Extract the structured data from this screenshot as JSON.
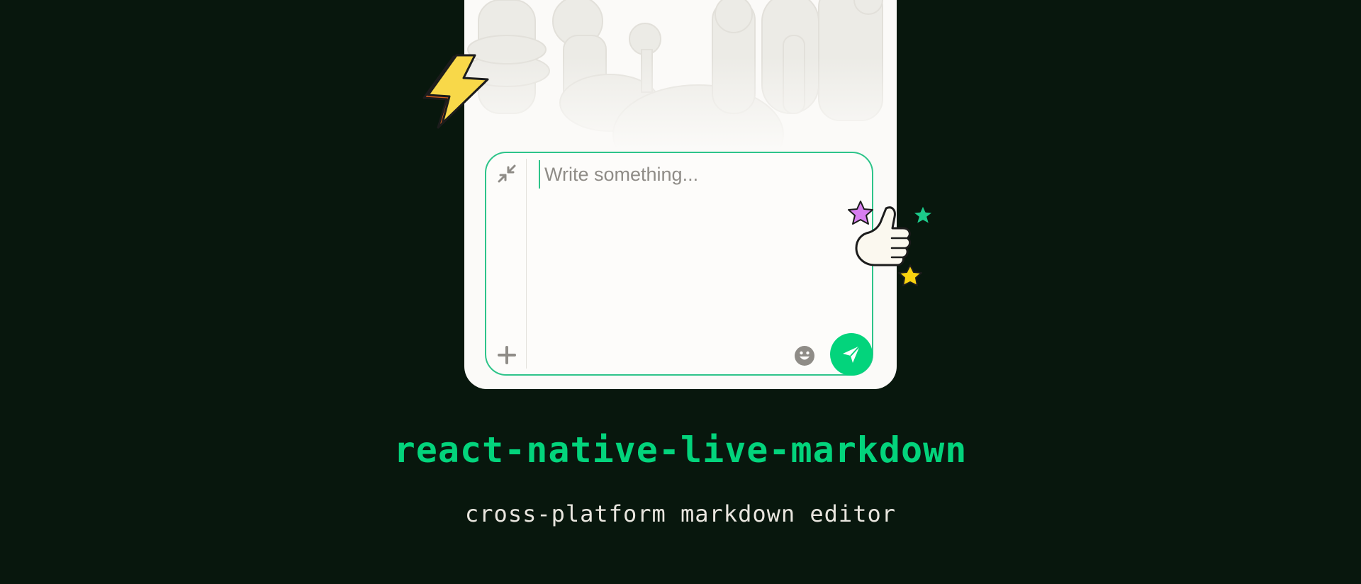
{
  "composer": {
    "placeholder": "Write something...",
    "value": ""
  },
  "icons": {
    "collapse": "collapse-arrows-icon",
    "add": "plus-icon",
    "emoji": "emoji-smiley-icon",
    "send": "paper-plane-icon",
    "lightning": "lightning-bolt-sticker",
    "thumbs_up": "thumbs-up-sticker",
    "stars": [
      "pink-star",
      "green-star",
      "yellow-star"
    ]
  },
  "branding": {
    "title": "react-native-live-markdown",
    "subtitle": "cross-platform markdown editor"
  },
  "colors": {
    "background": "#08170d",
    "accent": "#03d47c",
    "card": "#fbfaf8",
    "subtitle": "#e9e6df",
    "icon_gray": "#8f8c87"
  }
}
